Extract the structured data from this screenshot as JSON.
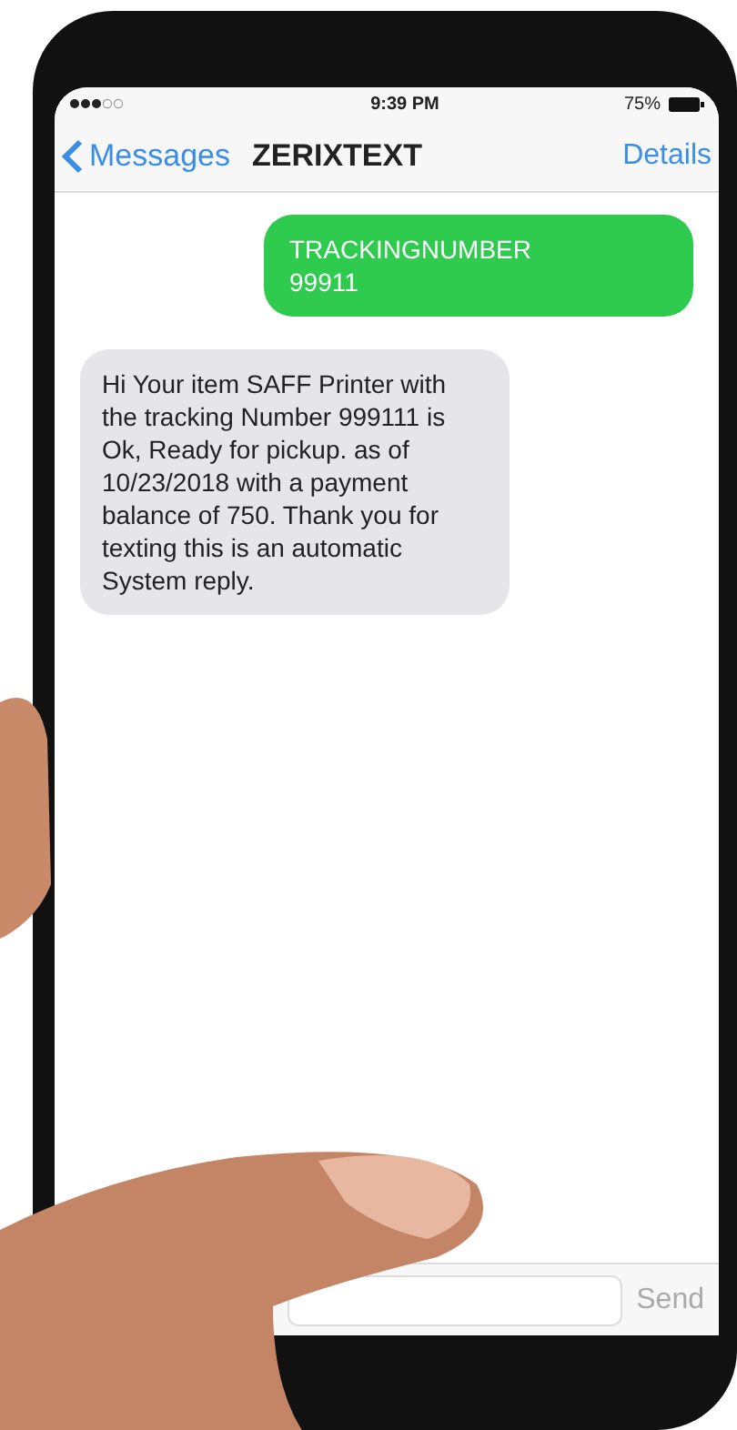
{
  "status_bar": {
    "time": "9:39 PM",
    "battery": "75%"
  },
  "nav": {
    "back": "Messages",
    "title": "ZERIXTEXT",
    "action": "Details"
  },
  "messages": [
    {
      "kind": "sent",
      "text": "TRACKINGNUMBER 99911"
    },
    {
      "kind": "received",
      "text": "Hi Your item SAFF Printer with the tracking Number 999111 is Ok, Ready for pickup. as of 10/23/2018 with a payment balance of 750. Thank you for texting this is an automatic System reply."
    }
  ],
  "composer": {
    "send": "Send"
  }
}
